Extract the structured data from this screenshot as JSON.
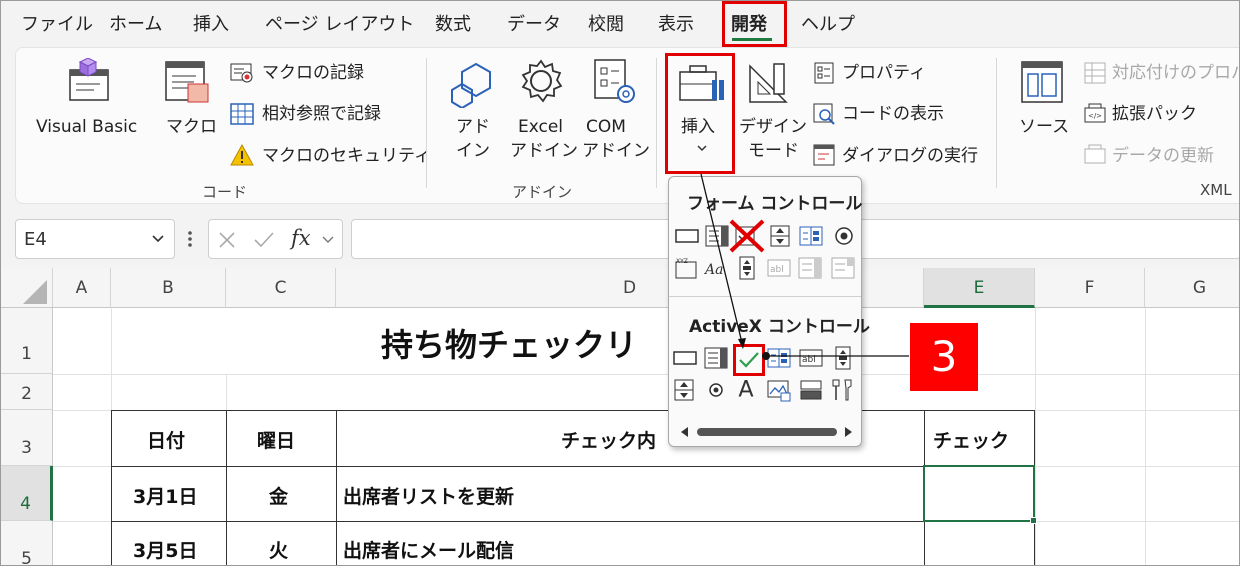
{
  "menu": {
    "items": [
      "ファイル",
      "ホーム",
      "挿入",
      "ページ レイアウト",
      "数式",
      "データ",
      "校閲",
      "表示",
      "開発",
      "ヘルプ"
    ],
    "active": "開発"
  },
  "ribbon": {
    "code_group": {
      "visual_basic": "Visual Basic",
      "macro": "マクロ",
      "record_macro": "マクロの記録",
      "relative_ref": "相対参照で記録",
      "macro_security": "マクロのセキュリティ",
      "label": "コード"
    },
    "addin_group": {
      "addin_l1": "アド",
      "addin_l2": "イン",
      "excel_l1": "Excel",
      "excel_l2": "アドイン",
      "com_l1": "COM",
      "com_l2": "アドイン",
      "label": "アドイン"
    },
    "controls_group": {
      "insert": "挿入",
      "design_l1": "デザイン",
      "design_l2": "モード",
      "properties": "プロパティ",
      "view_code": "コードの表示",
      "run_dialog": "ダイアログの実行"
    },
    "xml_group": {
      "source": "ソース",
      "map_props": "対応付けのプロパ",
      "expansion": "拡張パック",
      "refresh": "データの更新",
      "label": "XML"
    }
  },
  "formula_bar": {
    "name_box": "E4",
    "fx": "fx"
  },
  "sheet": {
    "columns": [
      "A",
      "B",
      "C",
      "D",
      "E",
      "F",
      "G"
    ],
    "rows": [
      "1",
      "2",
      "3",
      "4",
      "5"
    ],
    "title": "持ち物チェックリ",
    "headers": {
      "date": "日付",
      "weekday": "曜日",
      "content": "チェック内",
      "check": "チェック"
    },
    "data": [
      {
        "date": "3月1日",
        "weekday": "金",
        "content": "出席者リストを更新"
      },
      {
        "date": "3月5日",
        "weekday": "火",
        "content": "出席者にメール配信"
      }
    ]
  },
  "dropdown": {
    "form_controls_title": "フォーム コントロール",
    "activex_title": "ActiveX コントロール"
  },
  "annotation": {
    "step": "3",
    "color": "#ff0000"
  },
  "colors": {
    "accent_green": "#217346",
    "highlight_red": "#e00000"
  }
}
